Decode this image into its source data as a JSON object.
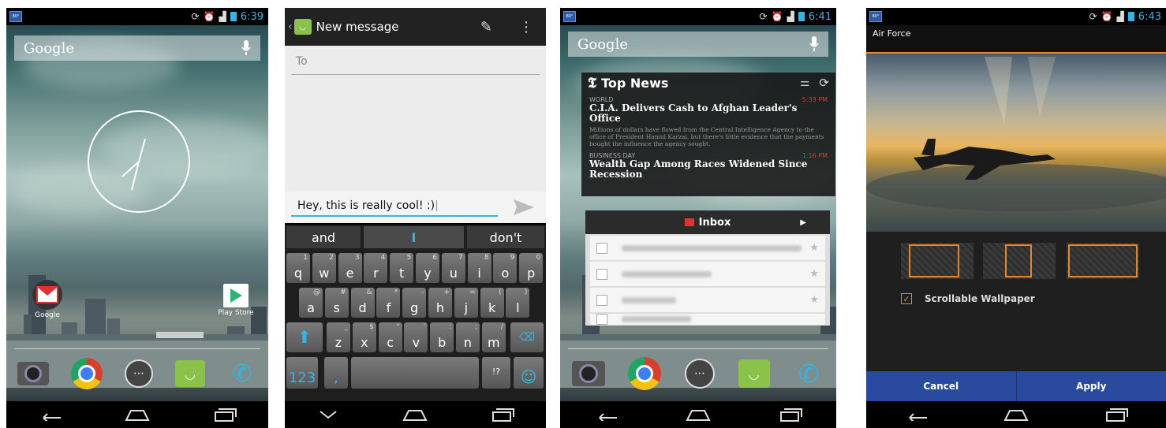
{
  "screens": {
    "home": {
      "time": "6:39",
      "search_label": "Google",
      "apps": [
        {
          "label": "Google"
        },
        {
          "label": "Play Store"
        }
      ]
    },
    "messaging": {
      "title": "New message",
      "to_placeholder": "To",
      "message_text": "Hey, this is really cool! :)",
      "suggestions": [
        "and",
        "I",
        "don't"
      ],
      "rows": {
        "row1": [
          [
            "q",
            "1"
          ],
          [
            "w",
            "2"
          ],
          [
            "e",
            "3"
          ],
          [
            "r",
            "4"
          ],
          [
            "t",
            "5"
          ],
          [
            "y",
            "6"
          ],
          [
            "u",
            "7"
          ],
          [
            "i",
            "8"
          ],
          [
            "o",
            "9"
          ],
          [
            "p",
            "0"
          ]
        ],
        "row2": [
          [
            "a",
            "@"
          ],
          [
            "s",
            "#"
          ],
          [
            "d",
            "&"
          ],
          [
            "f",
            "*"
          ],
          [
            "g",
            "-"
          ],
          [
            "h",
            "+"
          ],
          [
            "j",
            "="
          ],
          [
            "k",
            "("
          ],
          [
            "l",
            ")"
          ]
        ],
        "row3": [
          [
            "z",
            "_"
          ],
          [
            "x",
            "$"
          ],
          [
            "c",
            "\""
          ],
          [
            "v",
            "'"
          ],
          [
            "b",
            ":"
          ],
          [
            "n",
            ";"
          ],
          [
            "m",
            "/"
          ]
        ]
      },
      "symbols_key": "123",
      "comma_key": ",",
      "period_key": "!?"
    },
    "widgets": {
      "time": "6:41",
      "search_label": "Google",
      "news": {
        "title": "Top News",
        "items": [
          {
            "section": "WORLD",
            "time": "5:33 PM",
            "headline": "C.I.A. Delivers Cash to Afghan Leader's Office",
            "summary": "Millions of dollars have flowed from the Central Intelligence Agency to the office of President Hamid Karzai, but there's little evidence that the payments bought the influence the agency sought."
          },
          {
            "section": "BUSINESS DAY",
            "time": "1:16 PM",
            "headline": "Wealth Gap Among Races Widened Since Recession"
          }
        ]
      },
      "inbox": {
        "title": "Inbox"
      }
    },
    "wallpaper_picker": {
      "time": "6:43",
      "title": "Air Force",
      "scrollable_label": "Scrollable Wallpaper",
      "scrollable_checked": true,
      "cancel_label": "Cancel",
      "apply_label": "Apply"
    }
  },
  "colors": {
    "holo_blue": "#33b5e5",
    "accent_orange": "#e8862a",
    "news_time_red": "#e03b3b",
    "button_blue": "#2a4aa0"
  }
}
